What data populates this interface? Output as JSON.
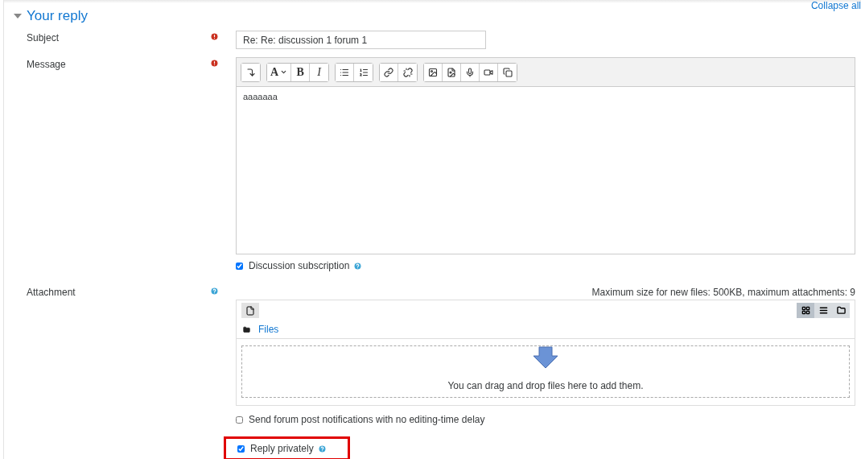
{
  "collapse_link": "Collapse all",
  "section": {
    "title": "Your reply",
    "expanded": true
  },
  "subject": {
    "label": "Subject",
    "required": true,
    "value": "Re: Re: discussion 1 forum 1"
  },
  "message": {
    "label": "Message",
    "required": true,
    "value": "aaaaaaa",
    "toolbar": [
      {
        "buttons": [
          {
            "kind": "icon"
          }
        ]
      },
      {
        "buttons": [
          {
            "kind": "menu",
            "label": "A"
          },
          {
            "kind": "bold",
            "label": "B"
          },
          {
            "kind": "italic",
            "label": "I"
          }
        ]
      },
      {
        "buttons": [
          {
            "kind": "icon"
          },
          {
            "kind": "icon"
          }
        ]
      },
      {
        "buttons": [
          {
            "kind": "icon"
          },
          {
            "kind": "icon"
          }
        ]
      },
      {
        "buttons": [
          {
            "kind": "icon"
          },
          {
            "kind": "icon"
          },
          {
            "kind": "icon"
          },
          {
            "kind": "icon"
          },
          {
            "kind": "icon"
          }
        ]
      }
    ]
  },
  "discussion_subscription": {
    "label": "Discussion subscription",
    "checked": true,
    "help": true
  },
  "attachment": {
    "label": "Attachment",
    "help": true,
    "limits": "Maximum size for new files: 500KB, maximum attachments: 9",
    "folder": "Files",
    "views": [
      {
        "selected": true
      },
      {
        "selected": false
      },
      {
        "selected": false
      }
    ],
    "drop_hint": "You can drag and drop files here to add them."
  },
  "options": [
    {
      "label": "Send forum post notifications with no editing-time delay",
      "checked": false,
      "help": false,
      "highlighted": false
    },
    {
      "label": "Reply privately",
      "checked": true,
      "help": true,
      "highlighted": true
    }
  ]
}
